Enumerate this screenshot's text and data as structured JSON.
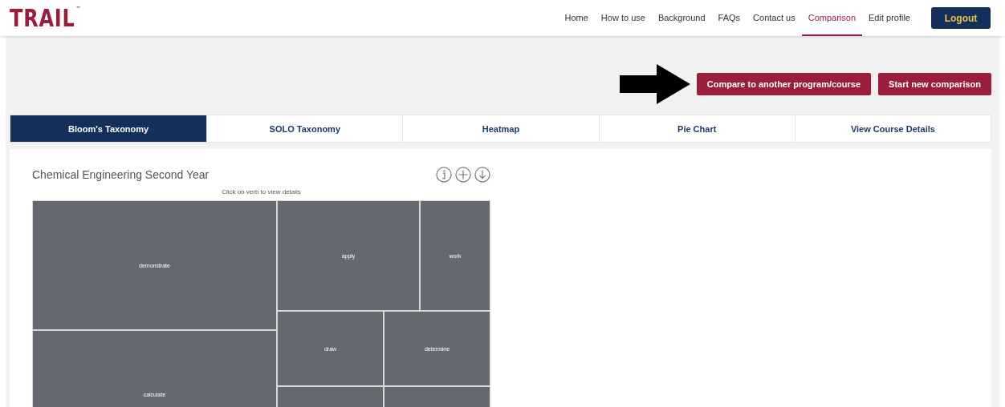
{
  "logo": {
    "text": "TRAIL",
    "mark": "™"
  },
  "nav": [
    {
      "label": "Home",
      "selected": false
    },
    {
      "label": "How to use",
      "selected": false
    },
    {
      "label": "Background",
      "selected": false
    },
    {
      "label": "FAQs",
      "selected": false
    },
    {
      "label": "Contact us",
      "selected": false
    },
    {
      "label": "Comparison",
      "selected": true
    },
    {
      "label": "Edit profile",
      "selected": false
    }
  ],
  "logout": "Logout",
  "actions": [
    "Compare to another program/course",
    "Start new comparison"
  ],
  "tabs": [
    {
      "label": "Bloom's Taxonomy",
      "selected": true
    },
    {
      "label": "SOLO Taxonomy",
      "selected": false
    },
    {
      "label": "Heatmap",
      "selected": false
    },
    {
      "label": "Pie Chart",
      "selected": false
    },
    {
      "label": "View Course Details",
      "selected": false
    }
  ],
  "panel": {
    "title": "Chemical Engineering Second Year",
    "hint": "Click on verb to view details"
  },
  "treemap": {
    "tiles": [
      {
        "label": "demonstrate"
      },
      {
        "label": "calculate"
      },
      {
        "label": "apply"
      },
      {
        "label": "work"
      },
      {
        "label": "draw"
      },
      {
        "label": "determine"
      }
    ]
  }
}
